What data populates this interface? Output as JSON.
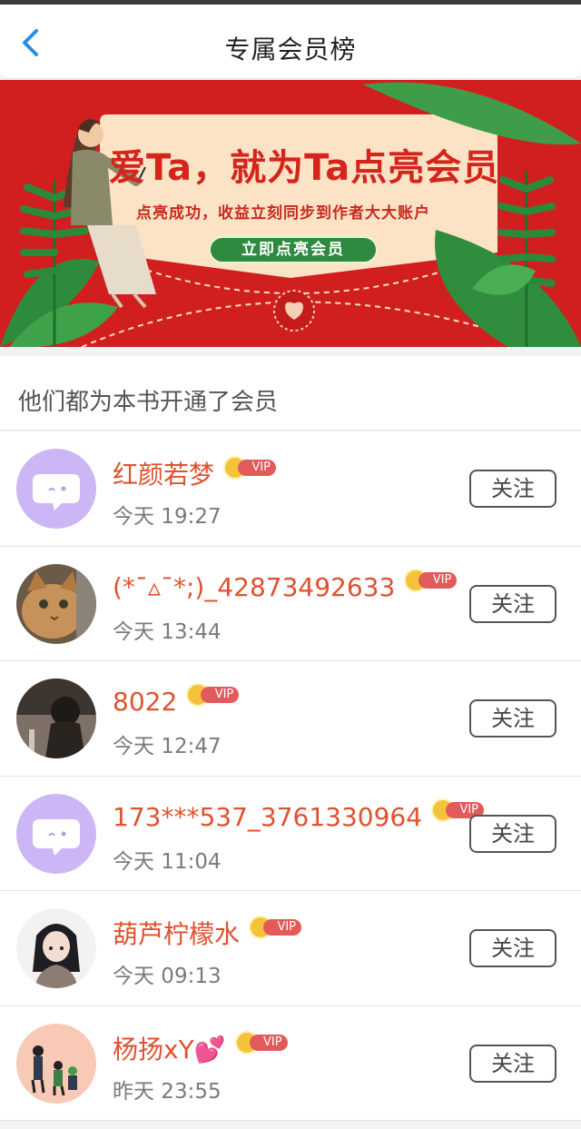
{
  "header": {
    "title": "专属会员榜",
    "back_icon": "chevron-left-icon"
  },
  "banner": {
    "title": "爱Ta，就为Ta点亮会员",
    "subtitle": "点亮成功，收益立刻同步到作者大大账户",
    "button_label": "立即点亮会员"
  },
  "section": {
    "title": "他们都为本书开通了会员"
  },
  "vip_label": "VIP",
  "members": [
    {
      "name": "红颜若梦",
      "time": "今天 19:27",
      "follow": "关注",
      "avatar": "default-chat-avatar"
    },
    {
      "name": "(*¯▵¯*;)_42873492633",
      "time": "今天 13:44",
      "follow": "关注",
      "avatar": "cat-photo-avatar"
    },
    {
      "name": "8022",
      "time": "今天 12:47",
      "follow": "关注",
      "avatar": "dark-photo-avatar"
    },
    {
      "name": "173***537_3761330964",
      "time": "今天 11:04",
      "follow": "关注",
      "avatar": "default-chat-avatar"
    },
    {
      "name": "葫芦柠檬水",
      "time": "今天 09:13",
      "follow": "关注",
      "avatar": "anime-girl-avatar"
    },
    {
      "name": "杨扬xY💕",
      "time": "昨天 23:55",
      "follow": "关注",
      "avatar": "kids-illustration-avatar"
    }
  ],
  "colors": {
    "accent": "#e0512f",
    "banner_red": "#d21e1e",
    "banner_green": "#2d8a3e",
    "avatar_purple": "#cdb6f5"
  }
}
